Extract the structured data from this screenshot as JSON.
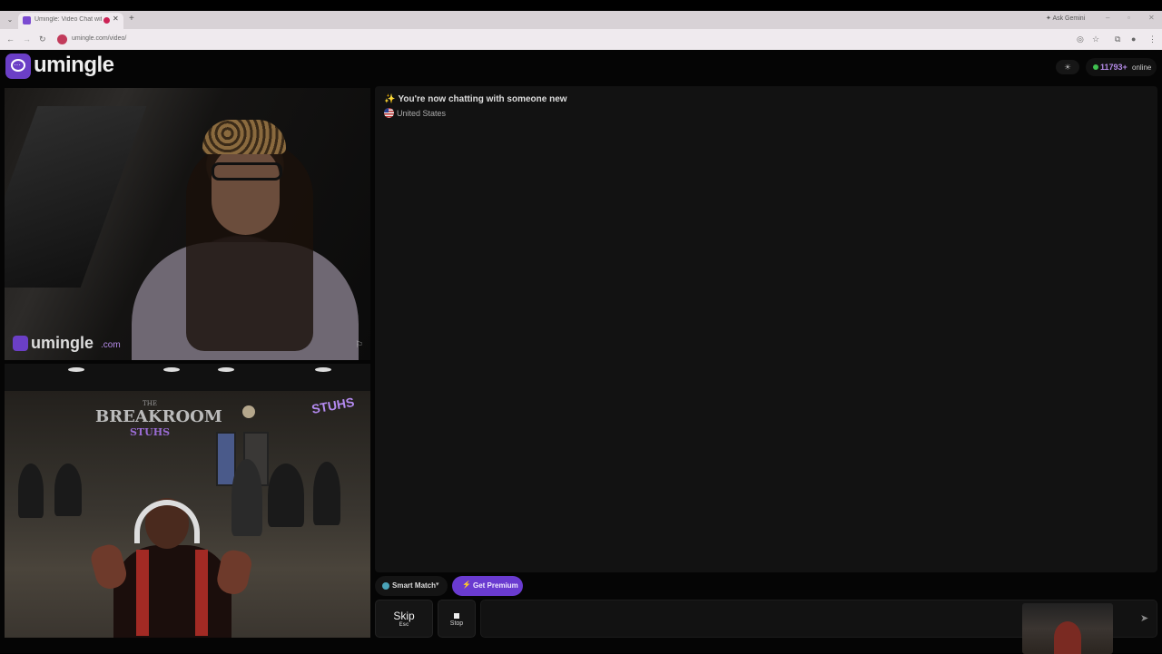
{
  "browser": {
    "tab_title": "Umingle: Video Chat with S",
    "tab_close": "✕",
    "new_tab": "+",
    "ask_gemini": "Ask Gemini",
    "url": "umingle.com/video/",
    "dropdown_icon": "chevron-down-icon",
    "back_glyph": "←",
    "forward_glyph": "→",
    "reload_glyph": "↻",
    "window_controls": [
      "–",
      "▫",
      "✕"
    ]
  },
  "header": {
    "logo_text": "umingle",
    "theme_glyph": "☀",
    "online_count": "11793+",
    "online_label": "online"
  },
  "video": {
    "watermark_text": "umingle",
    "watermark_suffix": ".com",
    "report_glyph": "⚐",
    "wall_sign": {
      "line1": "THE",
      "line2": "BREAKROOM",
      "line3": "STUHS"
    },
    "neon_sign": "STUHS"
  },
  "chat": {
    "sparkle": "✨",
    "message": "You're now chatting with someone new",
    "country": "United States",
    "input_placeholder": "",
    "send_glyph": "➤"
  },
  "controls": {
    "smart_match_label": "Smart Match",
    "smart_match_chevron": "▾",
    "premium_icon": "⚡",
    "premium_label": "Get Premium",
    "skip_label": "Skip",
    "skip_key": "Esc",
    "stop_label": "Stop"
  },
  "colors": {
    "brand_purple": "#6b3fc6",
    "online_green": "#3fbf4f",
    "count_text": "#b58be8",
    "background": "#050505",
    "panel": "#121212"
  }
}
